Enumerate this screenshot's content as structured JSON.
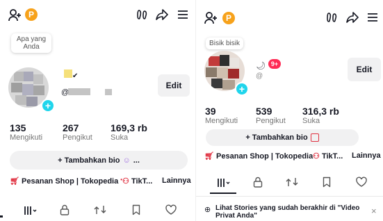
{
  "left": {
    "coin": "P",
    "bubble": "Apa yang Anda",
    "edit": "Edit",
    "handle_prefix": "@",
    "stats": [
      {
        "num": "135",
        "label": "Mengikuti"
      },
      {
        "num": "267",
        "label": "Pengikut"
      },
      {
        "num": "169,3 rb",
        "label": "Suka"
      }
    ],
    "bio_button": "+ Tambahkan bio",
    "bio_extra": "...",
    "links": {
      "shop": "Pesanan Shop | Tokopedia",
      "tiktok": "TikT...",
      "more": "Lainnya"
    }
  },
  "right": {
    "coin": "P",
    "bubble": "Bisik bisik",
    "badge": "9+",
    "handle_prefix": "@",
    "edit": "Edit",
    "stats": [
      {
        "num": "39",
        "label": "Mengikuti"
      },
      {
        "num": "539",
        "label": "Pengikut"
      },
      {
        "num": "316,3 rb",
        "label": "Suka"
      }
    ],
    "bio_button": "+ Tambahkan bio",
    "links": {
      "shop": "Pesanan Shop | Tokopedia",
      "tiktok": "TikT...",
      "more": "Lainnya"
    },
    "stories_text": "Lihat Stories yang sudah berakhir di \"Video Privat Anda\"",
    "close": "×"
  },
  "icons": [
    "add-user-icon",
    "coin-icon",
    "footprint-icon",
    "share-icon",
    "menu-icon",
    "grid-icon",
    "lock-icon",
    "repost-icon",
    "bookmark-icon",
    "heart-icon"
  ]
}
